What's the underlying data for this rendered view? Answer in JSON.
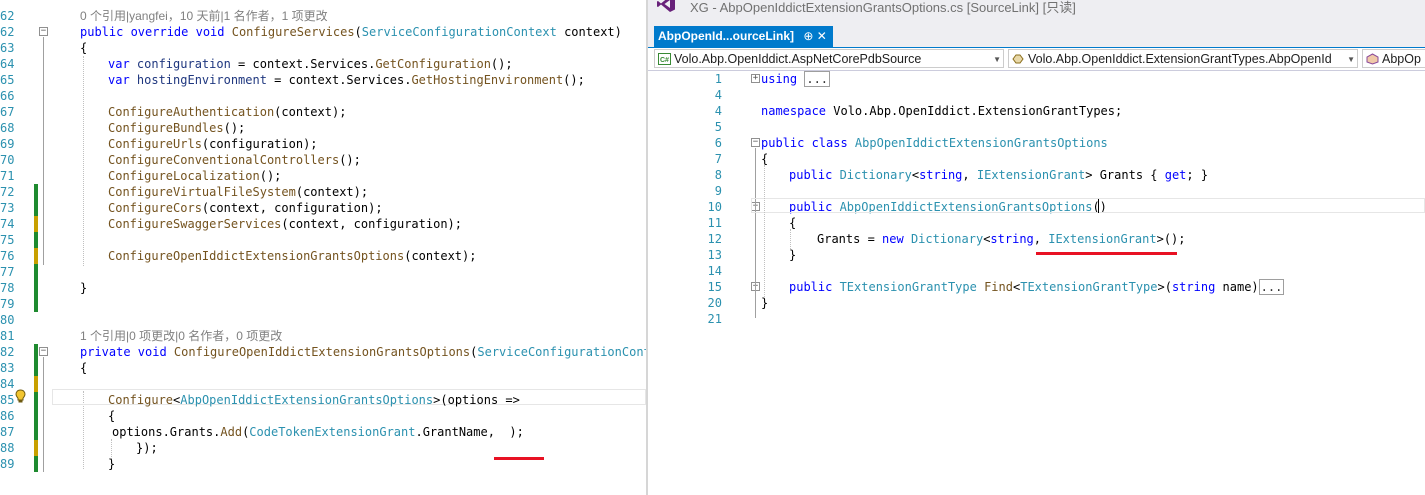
{
  "left_editor": {
    "lines": [
      {
        "n": "62",
        "kind": "lens",
        "text": "0 个引用|yangfei，10 天前|1 名作者，1 项更改"
      },
      {
        "n": "62",
        "parts": [
          [
            "kw",
            "public override void "
          ],
          [
            "me",
            "ConfigureServices"
          ],
          [
            "tx",
            "("
          ],
          [
            "ty",
            "ServiceConfigurationContext"
          ],
          [
            "tx",
            " context)"
          ]
        ]
      },
      {
        "n": "63",
        "parts": [
          [
            "tx",
            "{"
          ]
        ]
      },
      {
        "n": "64",
        "parts": [
          [
            "kw",
            "var "
          ],
          [
            "pa",
            "configuration"
          ],
          [
            "tx",
            " = context.Services."
          ],
          [
            "me",
            "GetConfiguration"
          ],
          [
            "tx",
            "();"
          ]
        ]
      },
      {
        "n": "65",
        "parts": [
          [
            "kw",
            "var "
          ],
          [
            "pa",
            "hostingEnvironment"
          ],
          [
            "tx",
            " = context.Services."
          ],
          [
            "me",
            "GetHostingEnvironment"
          ],
          [
            "tx",
            "();"
          ]
        ]
      },
      {
        "n": "66",
        "parts": []
      },
      {
        "n": "67",
        "parts": [
          [
            "me",
            "ConfigureAuthentication"
          ],
          [
            "tx",
            "(context);"
          ]
        ]
      },
      {
        "n": "68",
        "parts": [
          [
            "me",
            "ConfigureBundles"
          ],
          [
            "tx",
            "();"
          ]
        ]
      },
      {
        "n": "69",
        "parts": [
          [
            "me",
            "ConfigureUrls"
          ],
          [
            "tx",
            "(configuration);"
          ]
        ]
      },
      {
        "n": "70",
        "parts": [
          [
            "me",
            "ConfigureConventionalControllers"
          ],
          [
            "tx",
            "();"
          ]
        ]
      },
      {
        "n": "71",
        "parts": [
          [
            "me",
            "ConfigureLocalization"
          ],
          [
            "tx",
            "();"
          ]
        ]
      },
      {
        "n": "72",
        "parts": [
          [
            "me",
            "ConfigureVirtualFileSystem"
          ],
          [
            "tx",
            "(context);"
          ]
        ]
      },
      {
        "n": "73",
        "parts": [
          [
            "me",
            "ConfigureCors"
          ],
          [
            "tx",
            "(context, configuration);"
          ]
        ]
      },
      {
        "n": "74",
        "parts": [
          [
            "me",
            "ConfigureSwaggerServices"
          ],
          [
            "tx",
            "(context, configuration);"
          ]
        ]
      },
      {
        "n": "75",
        "parts": []
      },
      {
        "n": "76",
        "parts": [
          [
            "me",
            "ConfigureOpenIddictExtensionGrantsOptions"
          ],
          [
            "tx",
            "(context);"
          ]
        ]
      },
      {
        "n": "77",
        "parts": []
      },
      {
        "n": "78",
        "parts": [
          [
            "tx",
            "}"
          ]
        ]
      },
      {
        "n": "79",
        "parts": []
      },
      {
        "n": "80",
        "parts": []
      },
      {
        "n": "81",
        "kind": "lens",
        "text": "1 个引用|0 项更改|0 名作者，0 项更改"
      },
      {
        "n": "82",
        "parts": [
          [
            "kw",
            "private void "
          ],
          [
            "me",
            "ConfigureOpenIddictExtensionGrantsOptions"
          ],
          [
            "tx",
            "("
          ],
          [
            "ty",
            "ServiceConfigurationContex"
          ]
        ]
      },
      {
        "n": "83",
        "parts": [
          [
            "tx",
            "{"
          ]
        ]
      },
      {
        "n": "84",
        "parts": []
      },
      {
        "n": "85",
        "parts": [
          [
            "me",
            "Configure"
          ],
          [
            "tx",
            "<"
          ],
          [
            "ty",
            "AbpOpenIddictExtensionGrantsOptions"
          ],
          [
            "tx",
            ">(options =>"
          ]
        ]
      },
      {
        "n": "86",
        "parts": [
          [
            "tx",
            "{"
          ]
        ]
      },
      {
        "n": "87",
        "parts": [
          [
            "tx",
            "options.Grants."
          ],
          [
            "me",
            "Add"
          ],
          [
            "tx",
            "("
          ],
          [
            "ty",
            "CodeTokenExtensionGrant"
          ],
          [
            "tx",
            ".GrantName,  );"
          ]
        ]
      },
      {
        "n": "88",
        "parts": [
          [
            "tx",
            "});"
          ]
        ]
      },
      {
        "n": "89",
        "parts": [
          [
            "tx",
            "}"
          ]
        ]
      }
    ]
  },
  "right_window": {
    "title": "XG - AbpOpenIddictExtensionGrantsOptions.cs [SourceLink] [只读]",
    "tab_label": "AbpOpenId...ourceLink]",
    "tab_icons": "⊕ ✕",
    "nav": {
      "project": "Volo.Abp.OpenIddict.AspNetCorePdbSource",
      "type": "Volo.Abp.OpenIddict.ExtensionGrantTypes.AbpOpenId",
      "member": "AbpOp"
    },
    "lines": [
      {
        "n": "1",
        "parts": [
          [
            "kw",
            "using "
          ],
          [
            "box",
            "..."
          ]
        ]
      },
      {
        "n": "4",
        "parts": []
      },
      {
        "n": "4",
        "parts": [
          [
            "kw",
            "namespace "
          ],
          [
            "tx",
            "Volo.Abp.OpenIddict.ExtensionGrantTypes;"
          ]
        ]
      },
      {
        "n": "5",
        "parts": []
      },
      {
        "n": "6",
        "parts": [
          [
            "kw",
            "public class "
          ],
          [
            "ty",
            "AbpOpenIddictExtensionGrantsOptions"
          ]
        ]
      },
      {
        "n": "7",
        "parts": [
          [
            "tx",
            "{"
          ]
        ]
      },
      {
        "n": "8",
        "parts": [
          [
            "kw",
            "public "
          ],
          [
            "ty",
            "Dictionary"
          ],
          [
            "tx",
            "<"
          ],
          [
            "kw",
            "string"
          ],
          [
            "tx",
            ", "
          ],
          [
            "ty",
            "IExtensionGrant"
          ],
          [
            "tx",
            "> Grants { "
          ],
          [
            "kw",
            "get"
          ],
          [
            "tx",
            "; }"
          ]
        ]
      },
      {
        "n": "9",
        "parts": []
      },
      {
        "n": "10",
        "parts": [
          [
            "kw",
            "public "
          ],
          [
            "ty",
            "AbpOpenIddictExtensionGrantsOptions"
          ],
          [
            "tx",
            "()"
          ]
        ]
      },
      {
        "n": "11",
        "parts": [
          [
            "tx",
            "{"
          ]
        ]
      },
      {
        "n": "12",
        "parts": [
          [
            "tx",
            "Grants = "
          ],
          [
            "kw",
            "new "
          ],
          [
            "ty",
            "Dictionary"
          ],
          [
            "tx",
            "<"
          ],
          [
            "kw",
            "string"
          ],
          [
            "tx",
            ", "
          ],
          [
            "ty",
            "IExtensionGrant"
          ],
          [
            "tx",
            ">();"
          ]
        ]
      },
      {
        "n": "13",
        "parts": [
          [
            "tx",
            "}"
          ]
        ]
      },
      {
        "n": "14",
        "parts": []
      },
      {
        "n": "15",
        "parts": [
          [
            "kw",
            "public "
          ],
          [
            "ty",
            "TExtensionGrantType "
          ],
          [
            "me",
            "Find"
          ],
          [
            "tx",
            "<"
          ],
          [
            "ty",
            "TExtensionGrantType"
          ],
          [
            "tx",
            ">("
          ],
          [
            "kw",
            "string "
          ],
          [
            "tx",
            "name)"
          ],
          [
            "box",
            "..."
          ]
        ]
      },
      {
        "n": "20",
        "parts": [
          [
            "tx",
            "}"
          ]
        ]
      },
      {
        "n": "21",
        "parts": []
      }
    ]
  }
}
